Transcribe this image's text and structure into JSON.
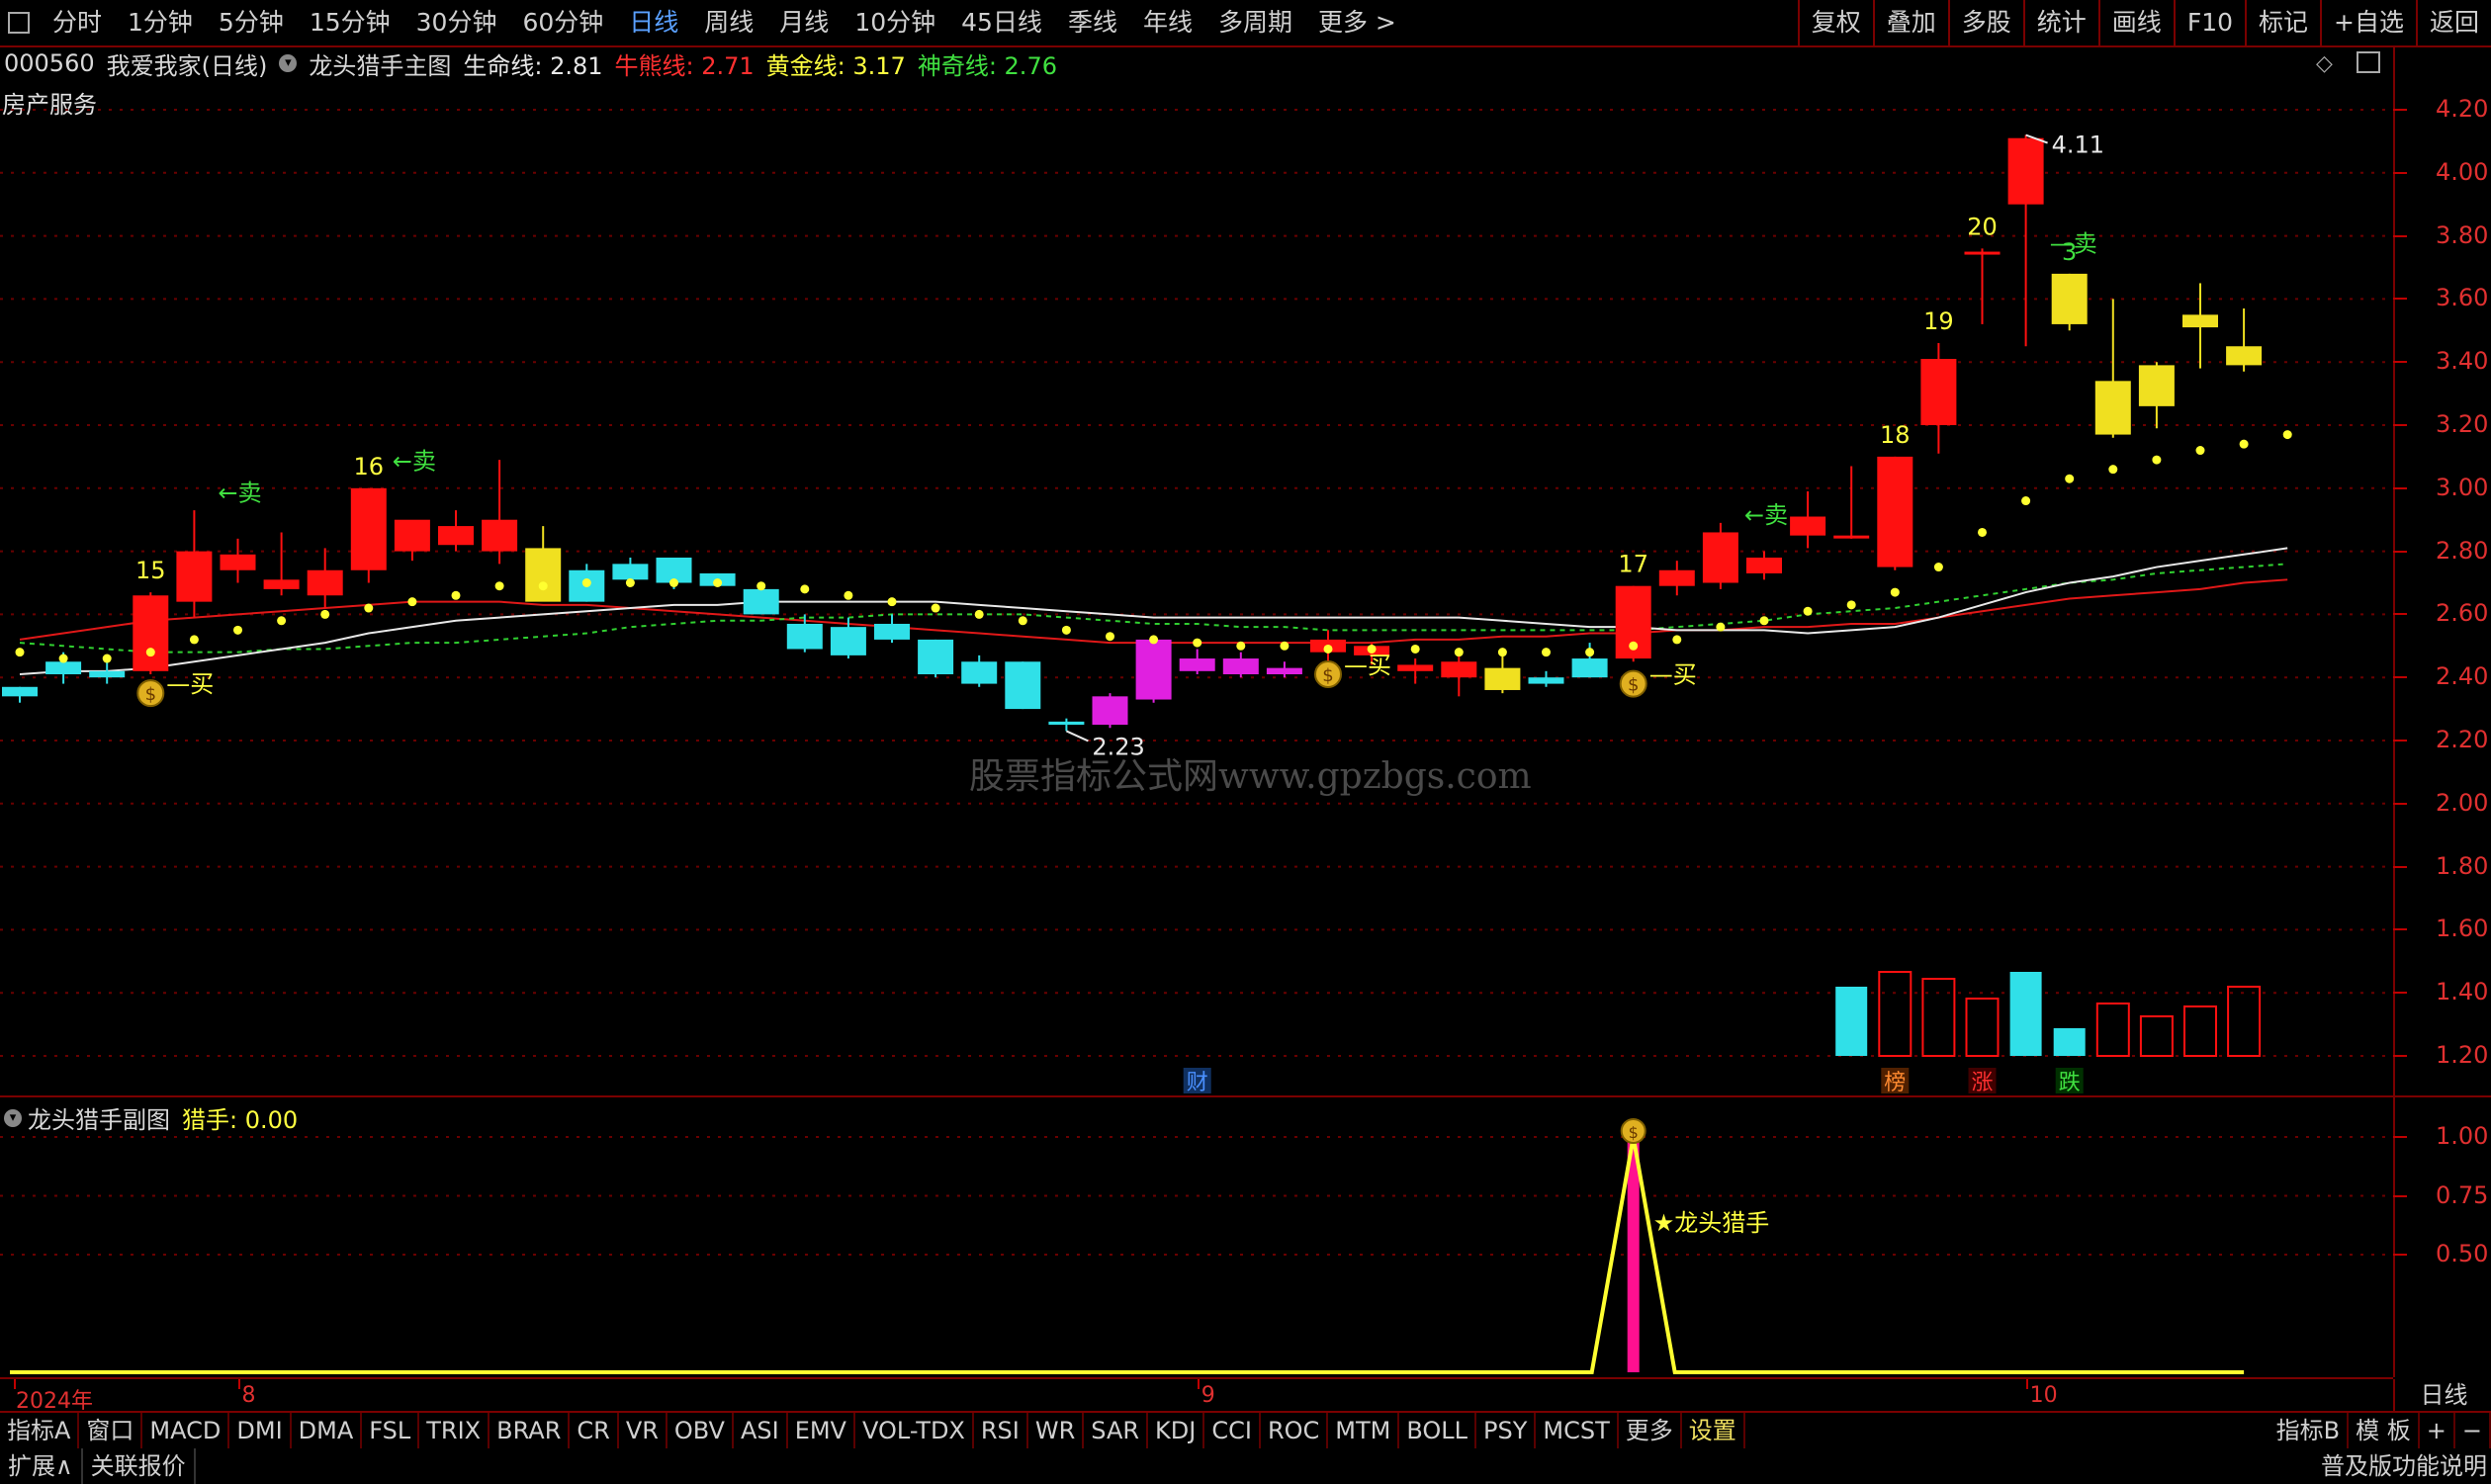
{
  "toolbar": {
    "periods": [
      "分时",
      "1分钟",
      "5分钟",
      "15分钟",
      "30分钟",
      "60分钟",
      "日线",
      "周线",
      "月线",
      "10分钟",
      "45日线",
      "季线",
      "年线",
      "多周期",
      "更多 >"
    ],
    "active_period": "日线",
    "right": [
      "复权",
      "叠加",
      "多股",
      "统计",
      "画线",
      "F10",
      "标记",
      "+自选",
      "返回"
    ]
  },
  "stock": {
    "code": "000560",
    "name": "我爱我家(日线)",
    "sector": "房产服务"
  },
  "main_indicator": {
    "name": "龙头猎手主图",
    "lines": [
      {
        "label": "生命线: 2.81",
        "color": "#e8e8e8"
      },
      {
        "label": "牛熊线: 2.71",
        "color": "#ff3030"
      },
      {
        "label": "黄金线: 3.17",
        "color": "#ffff40"
      },
      {
        "label": "神奇线: 2.76",
        "color": "#40e040"
      }
    ]
  },
  "sub_indicator": {
    "name": "龙头猎手副图",
    "value": "猎手: 0.00",
    "annotation": "★龙头猎手"
  },
  "watermark": "股票指标公式网www.gpzbgs.com",
  "chart_data": {
    "type": "candlestick",
    "y_ticks": [
      4.2,
      4.0,
      3.8,
      3.6,
      3.4,
      3.2,
      3.0,
      2.8,
      2.6,
      2.4,
      2.2,
      2.0,
      1.8,
      1.6,
      1.4,
      1.2
    ],
    "sub_y_ticks": [
      1.0,
      0.75,
      0.5
    ],
    "date_labels": [
      {
        "label": "2024年",
        "i": 0
      },
      {
        "label": "8",
        "i": 5
      },
      {
        "label": "9",
        "i": 27
      },
      {
        "label": "10",
        "i": 46
      }
    ],
    "candles": [
      {
        "o": 2.34,
        "h": 2.37,
        "l": 2.32,
        "c": 2.37,
        "k": "cyan"
      },
      {
        "o": 2.41,
        "h": 2.48,
        "l": 2.38,
        "c": 2.45,
        "k": "cyan"
      },
      {
        "o": 2.4,
        "h": 2.45,
        "l": 2.38,
        "c": 2.42,
        "k": "cyan"
      },
      {
        "o": 2.42,
        "h": 2.67,
        "l": 2.41,
        "c": 2.66,
        "k": "red"
      },
      {
        "o": 2.64,
        "h": 2.93,
        "l": 2.59,
        "c": 2.8,
        "k": "red"
      },
      {
        "o": 2.74,
        "h": 2.84,
        "l": 2.7,
        "c": 2.79,
        "k": "red"
      },
      {
        "o": 2.68,
        "h": 2.86,
        "l": 2.66,
        "c": 2.71,
        "k": "red"
      },
      {
        "o": 2.66,
        "h": 2.81,
        "l": 2.62,
        "c": 2.74,
        "k": "red"
      },
      {
        "o": 2.74,
        "h": 3.0,
        "l": 2.7,
        "c": 3.0,
        "k": "red"
      },
      {
        "o": 2.8,
        "h": 2.88,
        "l": 2.77,
        "c": 2.9,
        "k": "red"
      },
      {
        "o": 2.82,
        "h": 2.93,
        "l": 2.8,
        "c": 2.88,
        "k": "red"
      },
      {
        "o": 2.8,
        "h": 3.09,
        "l": 2.76,
        "c": 2.9,
        "k": "red"
      },
      {
        "o": 2.64,
        "h": 2.88,
        "l": 2.66,
        "c": 2.81,
        "k": "yellow"
      },
      {
        "o": 2.74,
        "h": 2.76,
        "l": 2.64,
        "c": 2.64,
        "k": "cyan"
      },
      {
        "o": 2.71,
        "h": 2.78,
        "l": 2.69,
        "c": 2.76,
        "k": "cyan"
      },
      {
        "o": 2.7,
        "h": 2.76,
        "l": 2.68,
        "c": 2.78,
        "k": "cyan"
      },
      {
        "o": 2.69,
        "h": 2.73,
        "l": 2.7,
        "c": 2.73,
        "k": "cyan"
      },
      {
        "o": 2.68,
        "h": 2.62,
        "l": 2.6,
        "c": 2.6,
        "k": "cyan"
      },
      {
        "o": 2.57,
        "h": 2.6,
        "l": 2.48,
        "c": 2.49,
        "k": "cyan"
      },
      {
        "o": 2.56,
        "h": 2.59,
        "l": 2.46,
        "c": 2.47,
        "k": "cyan"
      },
      {
        "o": 2.57,
        "h": 2.6,
        "l": 2.51,
        "c": 2.52,
        "k": "cyan"
      },
      {
        "o": 2.52,
        "h": 2.52,
        "l": 2.4,
        "c": 2.41,
        "k": "cyan"
      },
      {
        "o": 2.45,
        "h": 2.47,
        "l": 2.37,
        "c": 2.38,
        "k": "cyan"
      },
      {
        "o": 2.45,
        "h": 2.45,
        "l": 2.3,
        "c": 2.3,
        "k": "cyan"
      },
      {
        "o": 2.26,
        "h": 2.27,
        "l": 2.23,
        "c": 2.25,
        "k": "cyan"
      },
      {
        "o": 2.25,
        "h": 2.35,
        "l": 2.24,
        "c": 2.34,
        "k": "magenta"
      },
      {
        "o": 2.33,
        "h": 2.53,
        "l": 2.32,
        "c": 2.52,
        "k": "magenta"
      },
      {
        "o": 2.42,
        "h": 2.49,
        "l": 2.41,
        "c": 2.46,
        "k": "magenta"
      },
      {
        "o": 2.41,
        "h": 2.48,
        "l": 2.4,
        "c": 2.46,
        "k": "magenta"
      },
      {
        "o": 2.41,
        "h": 2.45,
        "l": 2.4,
        "c": 2.43,
        "k": "magenta"
      },
      {
        "o": 2.48,
        "h": 2.55,
        "l": 2.43,
        "c": 2.52,
        "k": "red"
      },
      {
        "o": 2.47,
        "h": 2.51,
        "l": 2.44,
        "c": 2.5,
        "k": "red"
      },
      {
        "o": 2.42,
        "h": 2.46,
        "l": 2.38,
        "c": 2.44,
        "k": "red"
      },
      {
        "o": 2.4,
        "h": 2.47,
        "l": 2.34,
        "c": 2.45,
        "k": "red"
      },
      {
        "o": 2.43,
        "h": 2.47,
        "l": 2.35,
        "c": 2.36,
        "k": "yellow"
      },
      {
        "o": 2.38,
        "h": 2.42,
        "l": 2.37,
        "c": 2.4,
        "k": "cyan"
      },
      {
        "o": 2.4,
        "h": 2.51,
        "l": 2.4,
        "c": 2.46,
        "k": "cyan"
      },
      {
        "o": 2.46,
        "h": 2.69,
        "l": 2.45,
        "c": 2.69,
        "k": "red"
      },
      {
        "o": 2.69,
        "h": 2.77,
        "l": 2.66,
        "c": 2.74,
        "k": "red"
      },
      {
        "o": 2.7,
        "h": 2.89,
        "l": 2.68,
        "c": 2.86,
        "k": "red"
      },
      {
        "o": 2.73,
        "h": 2.8,
        "l": 2.71,
        "c": 2.78,
        "k": "red"
      },
      {
        "o": 2.85,
        "h": 2.99,
        "l": 2.81,
        "c": 2.91,
        "k": "red"
      },
      {
        "o": 2.85,
        "h": 3.07,
        "l": 2.84,
        "c": 2.85,
        "k": "red"
      },
      {
        "o": 2.75,
        "h": 3.1,
        "l": 2.74,
        "c": 3.1,
        "k": "red"
      },
      {
        "o": 3.2,
        "h": 3.46,
        "l": 3.11,
        "c": 3.41,
        "k": "red"
      },
      {
        "o": 3.75,
        "h": 3.76,
        "l": 3.52,
        "c": 3.75,
        "k": "red"
      },
      {
        "o": 3.9,
        "h": 4.12,
        "l": 3.45,
        "c": 4.11,
        "k": "red"
      },
      {
        "o": 3.52,
        "h": 3.68,
        "l": 3.5,
        "c": 3.68,
        "k": "yellow"
      },
      {
        "o": 3.17,
        "h": 3.6,
        "l": 3.16,
        "c": 3.34,
        "k": "yellow"
      },
      {
        "o": 3.26,
        "h": 3.4,
        "l": 3.19,
        "c": 3.39,
        "k": "yellow"
      },
      {
        "o": 3.51,
        "h": 3.65,
        "l": 3.38,
        "c": 3.55,
        "k": "yellow"
      },
      {
        "o": 3.39,
        "h": 3.57,
        "l": 3.37,
        "c": 3.45,
        "k": "yellow"
      }
    ],
    "dots": [
      2.48,
      2.46,
      2.46,
      2.48,
      2.52,
      2.55,
      2.58,
      2.6,
      2.62,
      2.64,
      2.66,
      2.69,
      2.69,
      2.7,
      2.7,
      2.7,
      2.7,
      2.69,
      2.68,
      2.66,
      2.64,
      2.62,
      2.6,
      2.58,
      2.55,
      2.53,
      2.52,
      2.51,
      2.5,
      2.5,
      2.49,
      2.49,
      2.49,
      2.48,
      2.48,
      2.48,
      2.48,
      2.5,
      2.52,
      2.56,
      2.58,
      2.61,
      2.63,
      2.67,
      2.75,
      2.86,
      2.96,
      3.03,
      3.06,
      3.09,
      3.12,
      3.14,
      3.17
    ],
    "white_line": [
      2.41,
      2.42,
      2.42,
      2.43,
      2.45,
      2.47,
      2.49,
      2.51,
      2.54,
      2.56,
      2.58,
      2.59,
      2.6,
      2.61,
      2.62,
      2.63,
      2.63,
      2.64,
      2.64,
      2.64,
      2.64,
      2.64,
      2.63,
      2.62,
      2.61,
      2.6,
      2.59,
      2.59,
      2.59,
      2.59,
      2.59,
      2.59,
      2.59,
      2.59,
      2.58,
      2.57,
      2.56,
      2.56,
      2.55,
      2.55,
      2.55,
      2.54,
      2.55,
      2.56,
      2.59,
      2.63,
      2.67,
      2.7,
      2.72,
      2.75,
      2.77,
      2.79,
      2.81
    ],
    "red_line": [
      2.52,
      2.54,
      2.56,
      2.58,
      2.59,
      2.6,
      2.61,
      2.62,
      2.63,
      2.64,
      2.64,
      2.64,
      2.63,
      2.63,
      2.62,
      2.61,
      2.6,
      2.59,
      2.58,
      2.57,
      2.56,
      2.55,
      2.54,
      2.53,
      2.52,
      2.51,
      2.51,
      2.51,
      2.51,
      2.51,
      2.51,
      2.51,
      2.52,
      2.52,
      2.53,
      2.53,
      2.54,
      2.54,
      2.55,
      2.55,
      2.56,
      2.56,
      2.57,
      2.57,
      2.59,
      2.61,
      2.63,
      2.65,
      2.66,
      2.67,
      2.68,
      2.7,
      2.71
    ],
    "green_line": [
      2.51,
      2.5,
      2.49,
      2.48,
      2.48,
      2.48,
      2.49,
      2.49,
      2.5,
      2.51,
      2.51,
      2.52,
      2.53,
      2.54,
      2.56,
      2.57,
      2.58,
      2.58,
      2.59,
      2.59,
      2.6,
      2.6,
      2.6,
      2.6,
      2.59,
      2.58,
      2.57,
      2.57,
      2.56,
      2.56,
      2.55,
      2.55,
      2.55,
      2.55,
      2.55,
      2.55,
      2.55,
      2.55,
      2.56,
      2.57,
      2.58,
      2.6,
      2.61,
      2.62,
      2.64,
      2.66,
      2.68,
      2.7,
      2.71,
      2.73,
      2.74,
      2.75,
      2.76
    ],
    "labels": [
      {
        "i": 3,
        "text": "15",
        "pos": "above"
      },
      {
        "i": 8,
        "text": "16",
        "pos": "above"
      },
      {
        "i": 37,
        "text": "17",
        "pos": "above"
      },
      {
        "i": 43,
        "text": "18",
        "pos": "above"
      },
      {
        "i": 44,
        "text": "19",
        "pos": "above"
      },
      {
        "i": 45,
        "text": "20",
        "pos": "above"
      },
      {
        "i": 47,
        "text": "3",
        "pos": "above-green"
      }
    ],
    "sell_marks": [
      {
        "i": 5,
        "y": 2.96,
        "text": "←卖"
      },
      {
        "i": 9,
        "y": 3.06,
        "text": "←卖"
      },
      {
        "i": 40,
        "y": 2.89,
        "text": "←卖"
      },
      {
        "i": 47,
        "y": 3.75,
        "text": "—卖"
      }
    ],
    "buy_marks": [
      {
        "i": 3,
        "y": 2.35
      },
      {
        "i": 30,
        "y": 2.41
      },
      {
        "i": 37,
        "y": 2.38
      }
    ],
    "buy_text": "买",
    "high_label": {
      "i": 46,
      "text": "4.11"
    },
    "low_label": {
      "i": 24,
      "text": "2.23"
    },
    "money_icon_text": "$",
    "volume_bars": [
      {
        "i": 42,
        "v": 0.7,
        "k": "cyan"
      },
      {
        "i": 43,
        "v": 0.85,
        "k": "red"
      },
      {
        "i": 44,
        "v": 0.78,
        "k": "red"
      },
      {
        "i": 45,
        "v": 0.58,
        "k": "red"
      },
      {
        "i": 46,
        "v": 0.85,
        "k": "cyan"
      },
      {
        "i": 47,
        "v": 0.28,
        "k": "cyan"
      },
      {
        "i": 48,
        "v": 0.53,
        "k": "red"
      },
      {
        "i": 49,
        "v": 0.4,
        "k": "red"
      },
      {
        "i": 50,
        "v": 0.5,
        "k": "red"
      },
      {
        "i": 51,
        "v": 0.7,
        "k": "red"
      }
    ],
    "event_tags": [
      {
        "i": 27,
        "text": "财",
        "color": "#4a90ff",
        "bg": "#103060"
      },
      {
        "i": 43,
        "text": "榜",
        "color": "#ff8a30",
        "bg": "#502000"
      },
      {
        "i": 45,
        "text": "涨",
        "color": "#ff3030",
        "bg": "#400000"
      },
      {
        "i": 47,
        "text": "跌",
        "color": "#40e040",
        "bg": "#003000"
      }
    ],
    "sub_signal": {
      "i": 37,
      "value": 1.0
    }
  },
  "right_panel_label": "日线",
  "indicator_tabs": [
    "指标A",
    "窗口",
    "MACD",
    "DMI",
    "DMA",
    "FSL",
    "TRIX",
    "BRAR",
    "CR",
    "VR",
    "OBV",
    "ASI",
    "EMV",
    "VOL-TDX",
    "RSI",
    "WR",
    "SAR",
    "KDJ",
    "CCI",
    "ROC",
    "MTM",
    "BOLL",
    "PSY",
    "MCST",
    "更多",
    "设置"
  ],
  "indicator_right": [
    "指标B",
    "模 板",
    "+",
    "−"
  ],
  "status": {
    "left": [
      "扩展∧",
      "关联报价"
    ],
    "right": "普及版功能说明"
  }
}
